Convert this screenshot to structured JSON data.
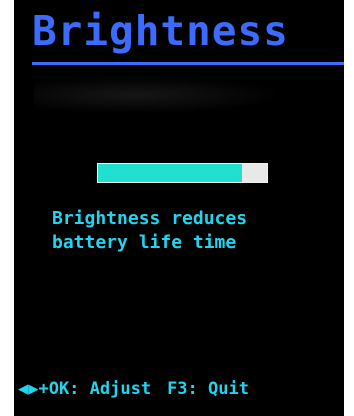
{
  "header": {
    "title": "Brightness"
  },
  "brightness": {
    "level_fraction": 0.85
  },
  "message": {
    "line1": "Brightness reduces",
    "line2": "battery life time"
  },
  "footer": {
    "adjust_hint": "◀▶+OK: Adjust",
    "quit_hint": "F3: Quit"
  },
  "colors": {
    "title": "#3b6cff",
    "text": "#22d4ee",
    "bar_fill": "#22e0d0",
    "bar_track": "#e8e8e8",
    "background": "#000000"
  }
}
